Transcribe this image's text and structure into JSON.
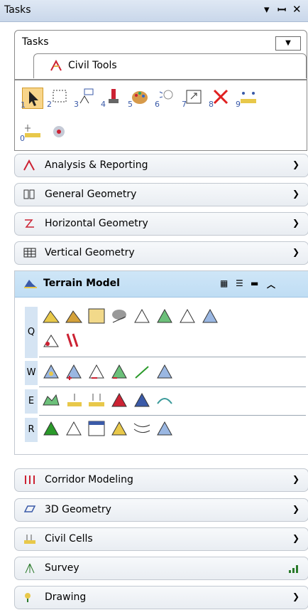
{
  "window": {
    "title": "Tasks",
    "controls": [
      "▾",
      "ꟷ",
      "✕"
    ]
  },
  "tasks_dropdown": {
    "label": "Tasks",
    "arrow_icon": "dropdown-arrow-icon"
  },
  "civil_tools": {
    "label": "Civil Tools",
    "icon": "civil-tools-icon"
  },
  "tools": [
    {
      "num": "1",
      "icon": "select-arrow-icon"
    },
    {
      "num": "2",
      "icon": "selection-box-icon"
    },
    {
      "num": "3",
      "icon": "place-element-icon"
    },
    {
      "num": "4",
      "icon": "paint-brush-icon"
    },
    {
      "num": "5",
      "icon": "palette-icon"
    },
    {
      "num": "6",
      "icon": "bulb-icon"
    },
    {
      "num": "7",
      "icon": "fit-view-icon"
    },
    {
      "num": "8",
      "icon": "delete-x-icon"
    },
    {
      "num": "9",
      "icon": "measure-distance-icon"
    },
    {
      "num": "0",
      "icon": "measure-point-icon"
    },
    {
      "num": "",
      "icon": "snap-tool-icon"
    }
  ],
  "panels": [
    {
      "label": "Analysis & Reporting",
      "icon": "analysis-icon"
    },
    {
      "label": "General Geometry",
      "icon": "general-geometry-icon"
    },
    {
      "label": "Horizontal Geometry",
      "icon": "horizontal-geometry-icon"
    },
    {
      "label": "Vertical Geometry",
      "icon": "vertical-geometry-icon"
    }
  ],
  "terrain": {
    "label": "Terrain Model",
    "rows": [
      {
        "key": "Q"
      },
      {
        "key": "W"
      },
      {
        "key": "E"
      },
      {
        "key": "R"
      }
    ]
  },
  "panels_bottom": [
    {
      "label": "Corridor Modeling",
      "icon": "corridor-icon"
    },
    {
      "label": "3D Geometry",
      "icon": "3d-geometry-icon"
    },
    {
      "label": "Civil Cells",
      "icon": "civil-cells-icon"
    },
    {
      "label": "Survey",
      "icon": "survey-icon"
    },
    {
      "label": "Drawing",
      "icon": "drawing-icon"
    }
  ],
  "colors": {
    "accent": "#3a5aa8",
    "header_blue": "#c8e0f5"
  }
}
